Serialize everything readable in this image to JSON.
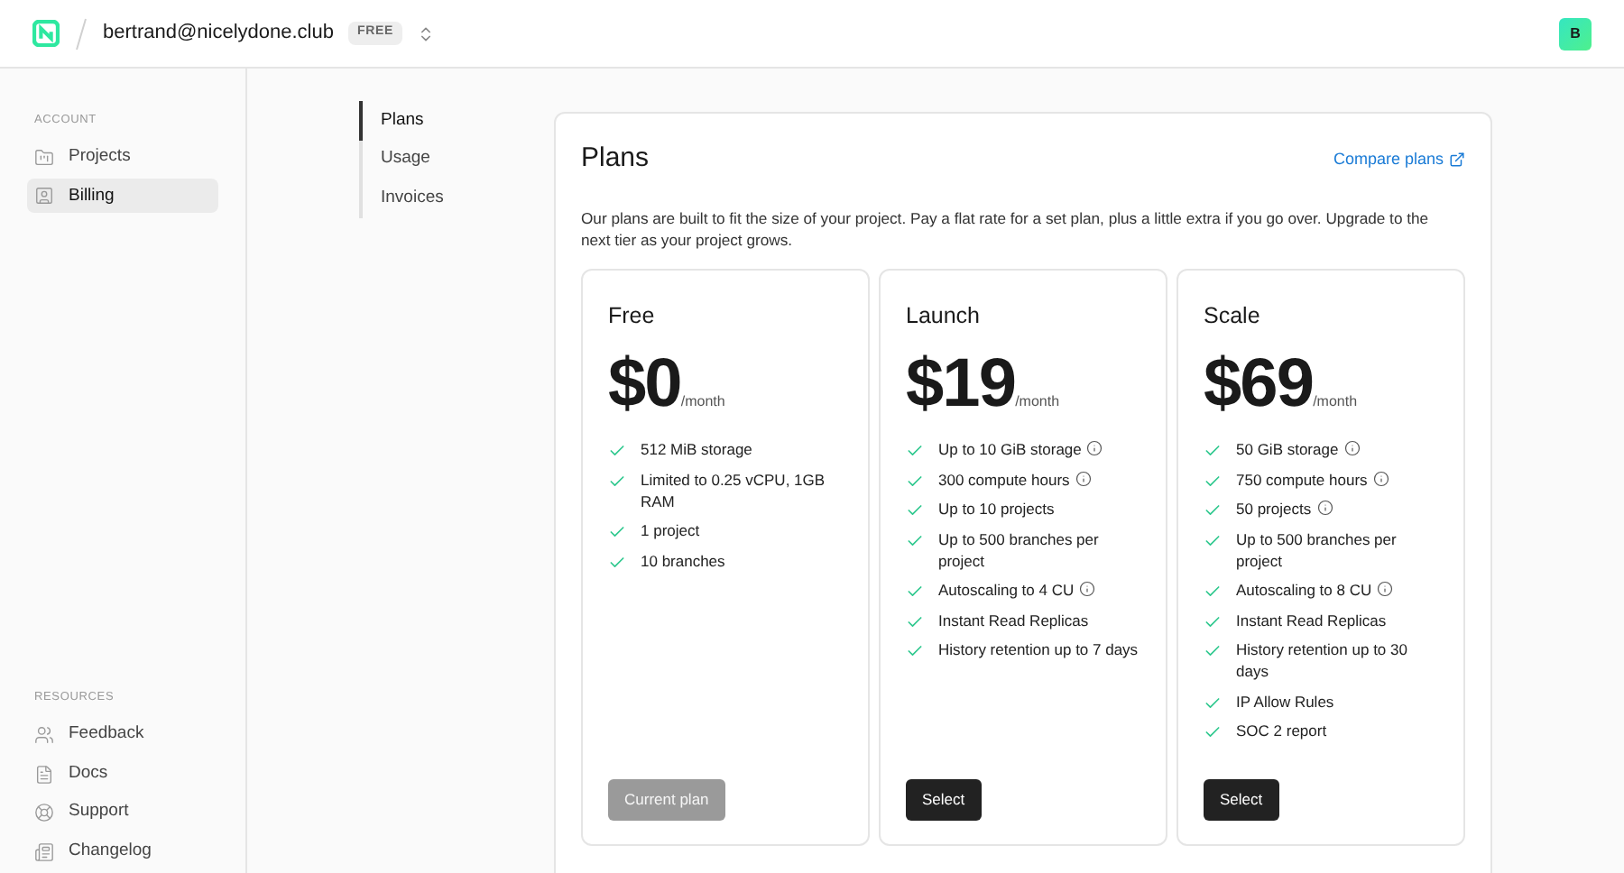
{
  "header": {
    "account": "bertrand@nicelydone.club",
    "badge": "FREE",
    "avatar": "B"
  },
  "sidebar": {
    "sections": [
      {
        "title": "ACCOUNT",
        "items": [
          {
            "label": "Projects",
            "selected": false
          },
          {
            "label": "Billing",
            "selected": true
          }
        ]
      },
      {
        "title": "RESOURCES",
        "items": [
          {
            "label": "Feedback",
            "selected": false
          },
          {
            "label": "Docs",
            "selected": false
          },
          {
            "label": "Support",
            "selected": false
          },
          {
            "label": "Changelog",
            "selected": false
          }
        ]
      }
    ]
  },
  "subnav": [
    {
      "label": "Plans",
      "selected": true
    },
    {
      "label": "Usage",
      "selected": false
    },
    {
      "label": "Invoices",
      "selected": false
    }
  ],
  "panel": {
    "title": "Plans",
    "link": "Compare plans",
    "description": "Our plans are built to fit the size of your project. Pay a flat rate for a set plan, plus a little extra if you go over. Upgrade to the next tier as your project grows.",
    "plans": [
      {
        "name": "Free",
        "price": "$0",
        "period": "/month",
        "button": "Current plan",
        "disabled": true,
        "features": [
          {
            "text": "512 MiB storage",
            "info": false
          },
          {
            "text": "Limited to 0.25 vCPU, 1GB RAM",
            "info": false
          },
          {
            "text": "1 project",
            "info": false
          },
          {
            "text": "10 branches",
            "info": false
          }
        ]
      },
      {
        "name": "Launch",
        "price": "$19",
        "period": "/month",
        "button": "Select",
        "disabled": false,
        "features": [
          {
            "text": "Up to 10 GiB storage",
            "info": true
          },
          {
            "text": "300 compute hours",
            "info": true
          },
          {
            "text": "Up to 10 projects",
            "info": false
          },
          {
            "text": "Up to 500 branches per project",
            "info": false
          },
          {
            "text": "Autoscaling to 4 CU",
            "info": true
          },
          {
            "text": "Instant Read Replicas",
            "info": false
          },
          {
            "text": "History retention up to 7 days",
            "info": false
          }
        ]
      },
      {
        "name": "Scale",
        "price": "$69",
        "period": "/month",
        "button": "Select",
        "disabled": false,
        "features": [
          {
            "text": "50 GiB storage",
            "info": true
          },
          {
            "text": "750 compute hours",
            "info": true
          },
          {
            "text": "50 projects",
            "info": true
          },
          {
            "text": "Up to 500 branches per project",
            "info": false
          },
          {
            "text": "Autoscaling to 8 CU",
            "info": true
          },
          {
            "text": "Instant Read Replicas",
            "info": false
          },
          {
            "text": "History retention up to 30 days",
            "info": false
          },
          {
            "text": "IP Allow Rules",
            "info": false
          },
          {
            "text": "SOC 2 report",
            "info": false
          }
        ]
      }
    ]
  }
}
